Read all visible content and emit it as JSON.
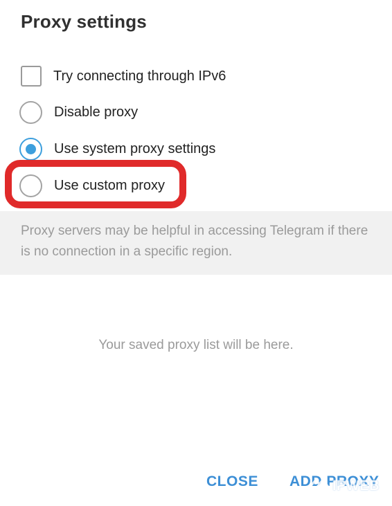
{
  "dialog": {
    "title": "Proxy settings"
  },
  "options": {
    "ipv6": {
      "label": "Try connecting through IPv6",
      "checked": false
    },
    "disable": {
      "label": "Disable proxy",
      "selected": false
    },
    "system": {
      "label": "Use system proxy settings",
      "selected": true
    },
    "custom": {
      "label": "Use custom proxy",
      "selected": false
    }
  },
  "info": {
    "text": "Proxy servers may be helpful in accessing Telegram if there is no connection in a specific region."
  },
  "empty_state": {
    "text": "Your saved proxy list will be here."
  },
  "buttons": {
    "close_label": "CLOSE",
    "add_label": "ADD PROXY"
  },
  "watermark": {
    "text": "IPWEB"
  },
  "colors": {
    "accent": "#3d9fdd",
    "button_text": "#3d8fd6",
    "highlight": "#e02a2a",
    "info_background": "#f1f1f1",
    "muted_text": "#9a9a9a"
  }
}
